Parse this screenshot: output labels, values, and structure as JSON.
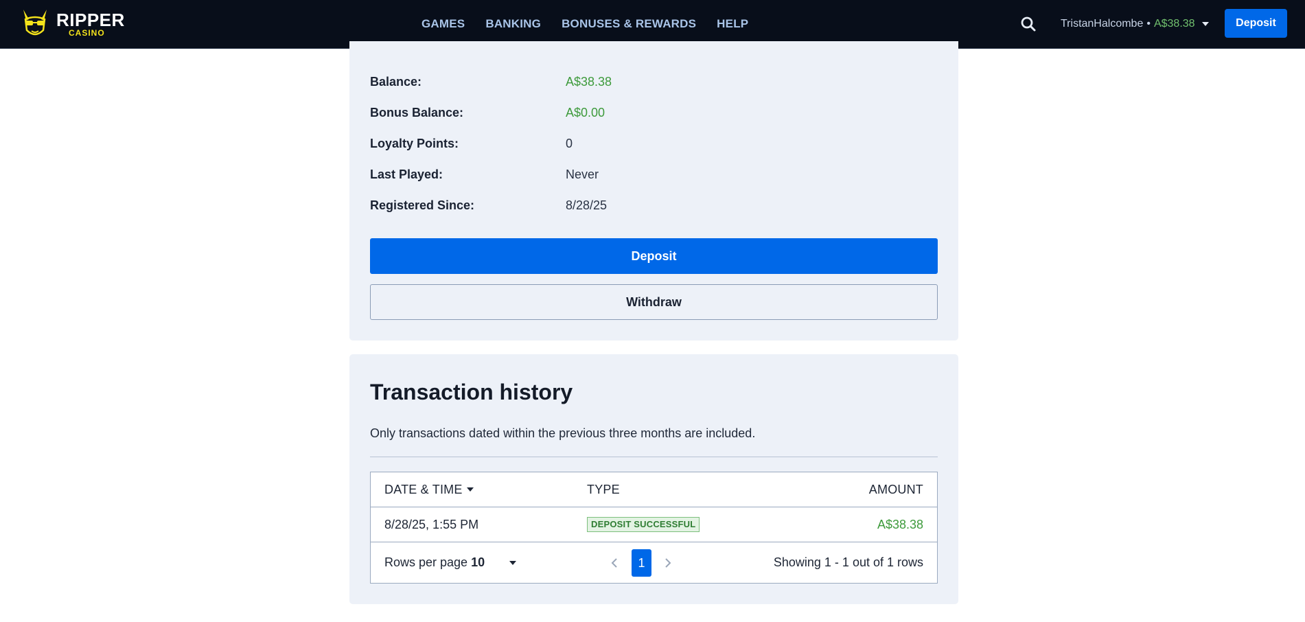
{
  "brand": {
    "name": "RIPPER",
    "sub": "CASINO"
  },
  "nav": {
    "items": [
      "GAMES",
      "BANKING",
      "BONUSES & REWARDS",
      "HELP"
    ]
  },
  "user": {
    "name": "TristanHalcombe",
    "separator": "•",
    "balance": "A$38.38"
  },
  "header": {
    "deposit_label": "Deposit"
  },
  "account": {
    "rows": [
      {
        "label": "Balance:",
        "value": "A$38.38"
      },
      {
        "label": "Bonus Balance:",
        "value": "A$0.00"
      },
      {
        "label": "Loyalty Points:",
        "value": "0"
      },
      {
        "label": "Last Played:",
        "value": "Never"
      },
      {
        "label": "Registered Since:",
        "value": "8/28/25"
      }
    ],
    "deposit_label": "Deposit",
    "withdraw_label": "Withdraw"
  },
  "history": {
    "title": "Transaction history",
    "note": "Only transactions dated within the previous three months are included.",
    "columns": {
      "date": "DATE & TIME",
      "type": "TYPE",
      "amount": "AMOUNT"
    },
    "rows": [
      {
        "date": "8/28/25, 1:55 PM",
        "type": "DEPOSIT SUCCESSFUL",
        "amount": "A$38.38"
      }
    ],
    "footer": {
      "rows_per_page_label": "Rows per page",
      "rows_per_page_value": "10",
      "current_page": "1",
      "showing": "Showing 1 - 1 out of 1 rows"
    }
  },
  "colors": {
    "accent": "#0068e8",
    "positive": "#3d9a3b",
    "topbar": "#080e1a",
    "panel": "#edf1f8"
  }
}
